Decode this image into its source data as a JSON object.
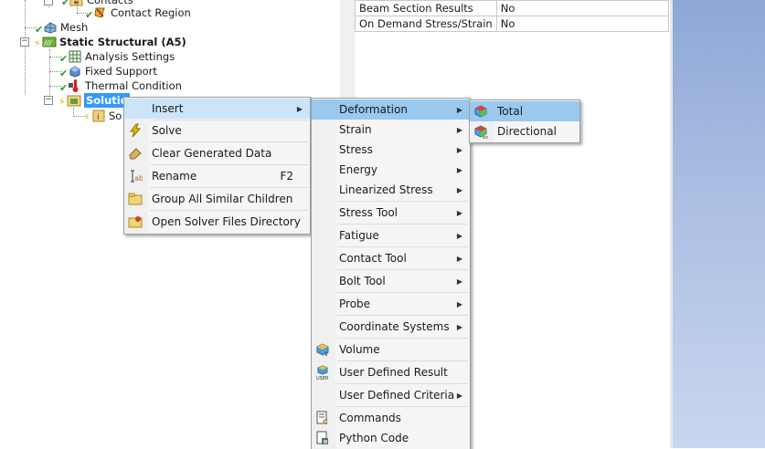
{
  "tree": {
    "contacts": "Contacts",
    "contact_region": "Contact Region",
    "mesh": "Mesh",
    "static_structural": "Static Structural (A5)",
    "analysis_settings": "Analysis Settings",
    "fixed_support": "Fixed Support",
    "thermal_condition": "Thermal Condition",
    "solution": "Solutio",
    "solution_child": "So"
  },
  "details": {
    "rows": [
      {
        "key": "Beam Section Results",
        "value": "No"
      },
      {
        "key": "On Demand Stress/Strain",
        "value": "No"
      }
    ]
  },
  "context_menu": {
    "insert": "Insert",
    "solve": "Solve",
    "clear_generated_data": "Clear Generated Data",
    "rename": "Rename",
    "rename_shortcut": "F2",
    "group_all_similar_children": "Group All Similar Children",
    "open_solver_files_directory": "Open Solver Files Directory"
  },
  "insert_menu": {
    "deformation": "Deformation",
    "strain": "Strain",
    "stress": "Stress",
    "energy": "Energy",
    "linearized_stress": "Linearized Stress",
    "stress_tool": "Stress Tool",
    "fatigue": "Fatigue",
    "contact_tool": "Contact Tool",
    "bolt_tool": "Bolt Tool",
    "probe": "Probe",
    "coordinate_systems": "Coordinate Systems",
    "volume": "Volume",
    "user_defined_result": "User Defined Result",
    "user_defined_criteria": "User Defined Criteria",
    "commands": "Commands",
    "python_code": "Python Code"
  },
  "deformation_menu": {
    "total": "Total",
    "directional": "Directional"
  }
}
